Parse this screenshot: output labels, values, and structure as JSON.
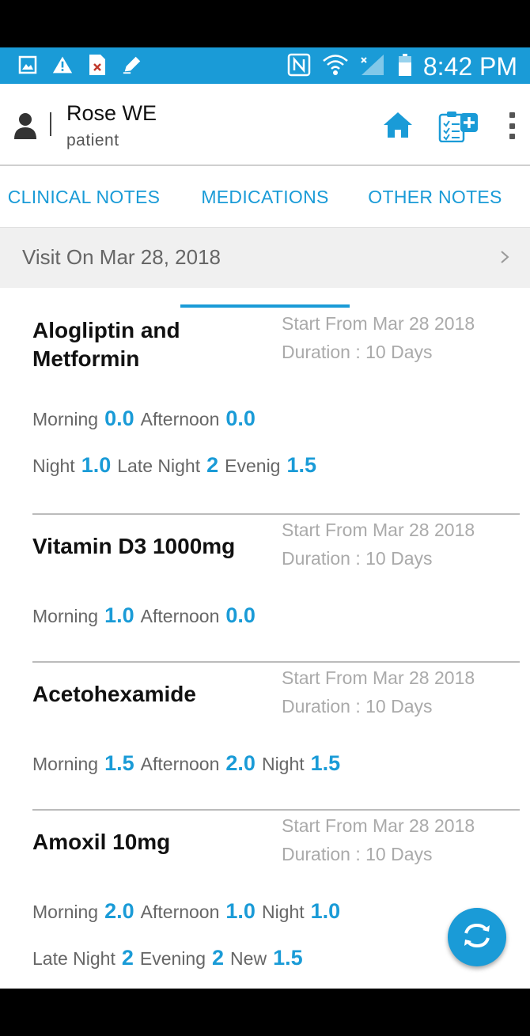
{
  "status_bar": {
    "time": "8:42 PM",
    "left_icons": [
      "image-icon",
      "warning-icon",
      "file-error-icon",
      "edit-icon"
    ],
    "right_icons": [
      "nfc-icon",
      "wifi-icon",
      "signal-icon",
      "battery-icon"
    ]
  },
  "header": {
    "name": "Rose WE",
    "role": "patient",
    "icons": [
      "person-icon",
      "home-icon",
      "clipboard-add-icon",
      "more-vert-icon"
    ]
  },
  "tabs": [
    {
      "label": "CLINICAL NOTES",
      "active": false
    },
    {
      "label": "MEDICATIONS",
      "active": true
    },
    {
      "label": "OTHER NOTES",
      "active": false
    }
  ],
  "visit": {
    "label": "Visit On Mar 28, 2018"
  },
  "medications": [
    {
      "name": "Alogliptin and Metformin",
      "start": "Start From Mar 28 2018",
      "duration": "Duration : 10 Days",
      "dose_rows": [
        [
          {
            "label": "Morning",
            "value": "0.0"
          },
          {
            "label": "Afternoon",
            "value": "0.0"
          }
        ],
        [
          {
            "label": "Night",
            "value": "1.0"
          },
          {
            "label": "Late Night",
            "value": "2"
          },
          {
            "label": "Evenig",
            "value": "1.5"
          }
        ]
      ]
    },
    {
      "name": "Vitamin D3 1000mg",
      "start": "Start From Mar 28 2018",
      "duration": "Duration : 10 Days",
      "dose_rows": [
        [
          {
            "label": "Morning",
            "value": "1.0"
          },
          {
            "label": "Afternoon",
            "value": "0.0"
          }
        ]
      ]
    },
    {
      "name": "Acetohexamide",
      "start": "Start From Mar 28 2018",
      "duration": "Duration : 10 Days",
      "dose_rows": [
        [
          {
            "label": "Morning",
            "value": "1.5"
          },
          {
            "label": "Afternoon",
            "value": "2.0"
          },
          {
            "label": "Night",
            "value": "1.5"
          }
        ]
      ]
    },
    {
      "name": "Amoxil 10mg",
      "start": "Start From Mar 28 2018",
      "duration": "Duration : 10 Days",
      "dose_rows": [
        [
          {
            "label": "Morning",
            "value": "2.0"
          },
          {
            "label": "Afternoon",
            "value": "1.0"
          },
          {
            "label": "Night",
            "value": "1.0"
          }
        ],
        [
          {
            "label": "Late Night",
            "value": "2"
          },
          {
            "label": "Evening",
            "value": "2"
          },
          {
            "label": "New",
            "value": "1.5"
          }
        ]
      ]
    }
  ],
  "fab": {
    "icon": "sync-icon"
  },
  "colors": {
    "accent": "#1a9bd7",
    "status_bar": "#1a9bd7",
    "muted": "#aaaaaa"
  }
}
